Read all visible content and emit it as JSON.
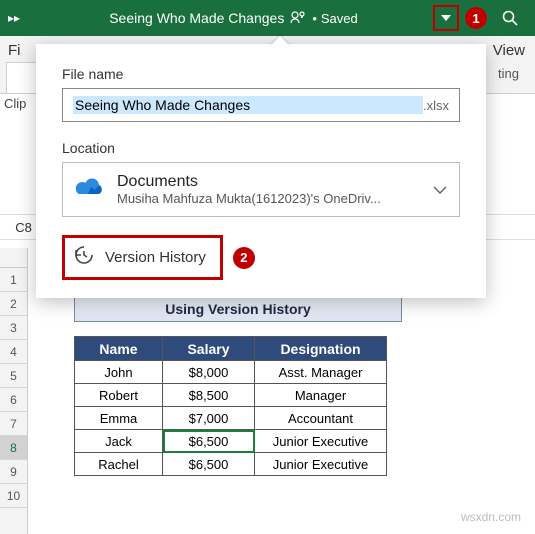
{
  "titlebar": {
    "expand_glyph": "▸▸",
    "doc_title": "Seeing Who Made Changes",
    "saved_label": "Saved",
    "callout1": "1"
  },
  "ribbon": {
    "left_tab": "Fi",
    "right_tab": "View",
    "right_group": "ting ",
    "clip_label": "Clip"
  },
  "flyout": {
    "file_name_label": "File name",
    "file_name_value": "Seeing Who Made Changes",
    "file_ext": ".xlsx",
    "location_label": "Location",
    "location_title": "Documents",
    "location_path": "Musiha Mahfuza Mukta(1612023)'s OneDriv...",
    "version_history_label": "Version History",
    "callout2": "2"
  },
  "cell_ref": "C8",
  "rows": [
    "1",
    "2",
    "3",
    "4",
    "5",
    "6",
    "7",
    "8",
    "9",
    "10"
  ],
  "selected_row_index": 7,
  "section_title": "Using Version History",
  "table": {
    "headers": [
      "Name",
      "Salary",
      "Designation"
    ],
    "rows": [
      [
        "John",
        "$8,000",
        "Asst. Manager"
      ],
      [
        "Robert",
        "$8,500",
        "Manager"
      ],
      [
        "Emma",
        "$7,000",
        "Accountant"
      ],
      [
        "Jack",
        "$6,500",
        "Junior Executive"
      ],
      [
        "Rachel",
        "$6,500",
        "Junior Executive"
      ]
    ],
    "active": {
      "r": 3,
      "c": 1
    }
  },
  "watermark": "wsxdn.com"
}
